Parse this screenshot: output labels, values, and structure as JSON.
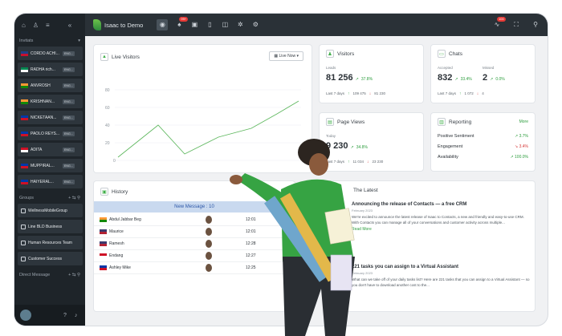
{
  "topbar": {
    "logo_text": "Isaac to Demo",
    "notif_badge": "99+",
    "right_badge": "100"
  },
  "sidebar": {
    "contacts_header": "Invitats",
    "contacts": [
      {
        "name": "CORDO ACHI...",
        "tag": "ENG...",
        "flag": "gb"
      },
      {
        "name": "RADHA rich...",
        "tag": "ENG...",
        "flag": "ng"
      },
      {
        "name": "ANVROSH",
        "tag": "ENG...",
        "flag": "in"
      },
      {
        "name": "KRISHNAN...",
        "tag": "ENG...",
        "flag": "in"
      },
      {
        "name": "NICKETAAN...",
        "tag": "ENG...",
        "flag": "ph"
      },
      {
        "name": "PAOLO REYS...",
        "tag": "ENG...",
        "flag": "ph"
      },
      {
        "name": "ADITA",
        "tag": "ENG...",
        "flag": "id"
      },
      {
        "name": "MUPPIRAL...",
        "tag": "ENG...",
        "flag": "ph"
      },
      {
        "name": "HAIYERAL...",
        "tag": "ENG...",
        "flag": "ph"
      }
    ],
    "groups_header": "Groups",
    "groups": [
      {
        "name": "WellnessMobileGroup"
      },
      {
        "name": "Line BLD Business"
      },
      {
        "name": "Human Resources Team"
      },
      {
        "name": "Customer Success"
      }
    ],
    "direct_header": "Direct Message"
  },
  "live_visitors": {
    "title": "Live Visitors",
    "select": "Live Now",
    "y_ticks": [
      "80",
      "60",
      "40",
      "20",
      "0"
    ]
  },
  "visitors": {
    "title": "Visitors",
    "label": "Leads",
    "value": "81 256",
    "change": "37.8%",
    "footer": "Last 7 days",
    "up_val": "109 475",
    "down_val": "81 230"
  },
  "chats": {
    "title": "Chats",
    "label_a": "Accepted",
    "label_b": "Missed",
    "value_a": "832",
    "change_a": "33.4%",
    "value_b": "2",
    "change_b": "0.0%",
    "footer": "Last 7 days",
    "up_val": "1 072",
    "down_val": "4"
  },
  "page_views": {
    "title": "Page Views",
    "label": "Today",
    "value": "9 230",
    "change": "34.8%",
    "footer": "Last 7 days",
    "up_val": "11 034",
    "down_val": "23 230"
  },
  "reporting": {
    "title": "Reporting",
    "more": "More",
    "rows": [
      {
        "label": "Positive Sentiment",
        "value": "3.7%",
        "dir": "up"
      },
      {
        "label": "Engagement",
        "value": "3.4%",
        "dir": "down"
      },
      {
        "label": "Availability",
        "value": "100.0%",
        "dir": "up"
      }
    ]
  },
  "history": {
    "title": "History",
    "new_message": "New Message : 10",
    "rows": [
      {
        "name": "Abdul Jabbar Beg",
        "time": "12:01",
        "flag": "in"
      },
      {
        "name": "Maurice",
        "time": "12:01",
        "flag": "us"
      },
      {
        "name": "Ramesh",
        "time": "12:28",
        "flag": "us"
      },
      {
        "name": "Endang",
        "time": "12:27",
        "flag": "id"
      },
      {
        "name": "Ashley Mike",
        "time": "12:25",
        "flag": "ph"
      }
    ]
  },
  "latest": {
    "title": "The Latest",
    "items": [
      {
        "title": "Announcing the release of Contacts — a free CRM",
        "date": "February 2023",
        "body": "We're excited to announce the latest release of Isaac to Contacts, a new and friendly and easy-to-use CRM. With Contacts you can manage all of your conversations and customer activity across multiple...",
        "more": "Read More"
      },
      {
        "title": "221 tasks you can assign to a Virtual Assistant",
        "date": "February 2023",
        "body": "What can we take off of your daily tasks list? Here are 221 tasks that you can assign to a Virtual Assistant — so you don't have to download another cost to the..."
      }
    ]
  }
}
